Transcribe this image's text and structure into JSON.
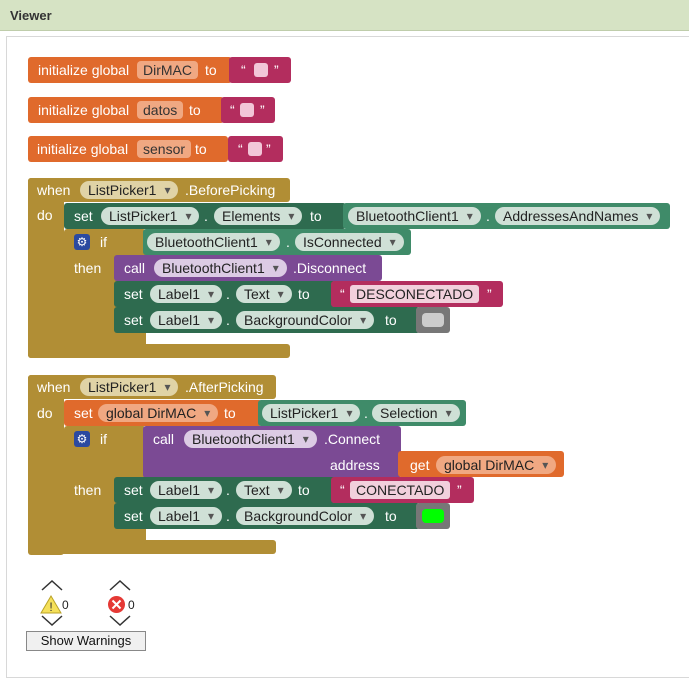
{
  "window": {
    "title": "Viewer"
  },
  "globals": [
    {
      "prefix": "initialize global",
      "name": "DirMAC",
      "to": "to"
    },
    {
      "prefix": "initialize global",
      "name": "datos",
      "to": "to"
    },
    {
      "prefix": "initialize global",
      "name": "sensor",
      "to": "to"
    }
  ],
  "quotes": {
    "open": "“",
    "close": "”"
  },
  "event1": {
    "when": "when",
    "component": "ListPicker1",
    "event": ".BeforePicking",
    "do": "do",
    "set1": {
      "set": "set",
      "component": "ListPicker1",
      "dot": ".",
      "property": "Elements",
      "to": "to",
      "value_component": "BluetoothClient1",
      "value_property": "AddressesAndNames"
    },
    "if": {
      "if": "if",
      "then": "then",
      "component": "BluetoothClient1",
      "property": "IsConnected"
    },
    "call": {
      "call": "call",
      "component": "BluetoothClient1",
      "method": ".Disconnect"
    },
    "set2": {
      "set": "set",
      "component": "Label1",
      "property": "Text",
      "to": "to",
      "value": "DESCONECTADO"
    },
    "set3": {
      "set": "set",
      "component": "Label1",
      "property": "BackgroundColor",
      "to": "to",
      "color": "#cccccc"
    }
  },
  "event2": {
    "when": "when",
    "component": "ListPicker1",
    "event": ".AfterPicking",
    "do": "do",
    "set1": {
      "set": "set",
      "global": "global DirMAC",
      "to": "to",
      "value_component": "ListPicker1",
      "value_property": "Selection"
    },
    "if": {
      "if": "if",
      "then": "then"
    },
    "call": {
      "call": "call",
      "component": "BluetoothClient1",
      "method": ".Connect",
      "address": "address",
      "get": "get",
      "get_var": "global DirMAC"
    },
    "set2": {
      "set": "set",
      "component": "Label1",
      "property": "Text",
      "to": "to",
      "value": "CONECTADO"
    },
    "set3": {
      "set": "set",
      "component": "Label1",
      "property": "BackgroundColor",
      "to": "to",
      "color": "#00ff00"
    }
  },
  "warnings": {
    "warning_count": "0",
    "error_count": "0",
    "button": "Show Warnings"
  },
  "colors": {
    "variables": "#e06a2c",
    "text": "#b32d5e",
    "control": "#b18e35",
    "component_set": "#2e6b4f",
    "component_get": "#3f8b69",
    "call": "#7b4a94",
    "dropdown": "#cccccc"
  }
}
